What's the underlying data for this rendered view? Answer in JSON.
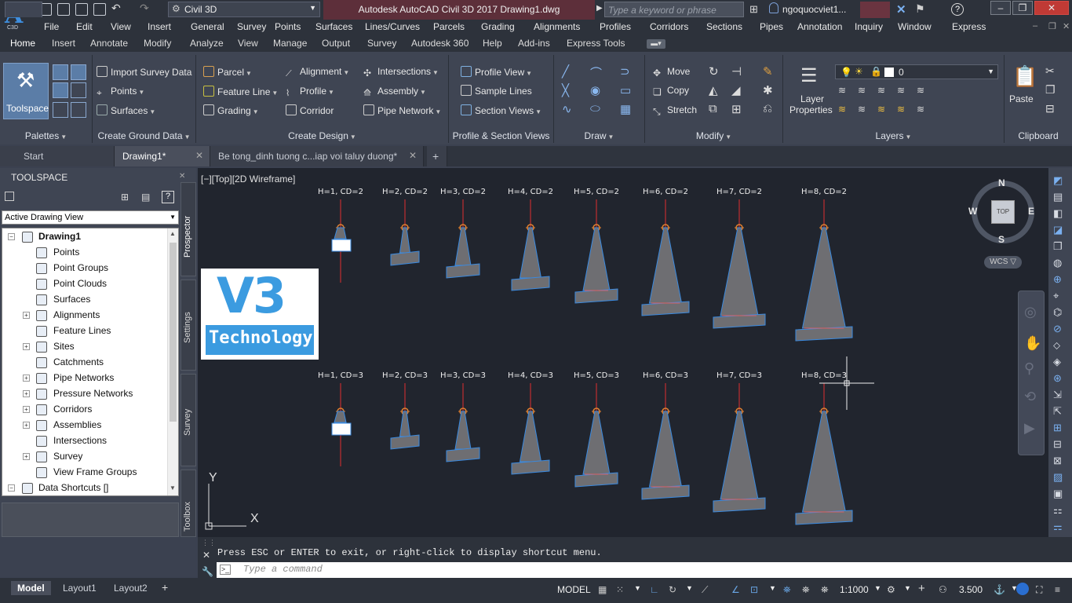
{
  "app": {
    "logo_letter": "A",
    "logo_sub": "C3D",
    "workspace": "Civil 3D",
    "title": "Autodesk AutoCAD Civil 3D 2017    Drawing1.dwg",
    "search_placeholder": "Type a keyword or phrase",
    "user": "ngoquocviet1...",
    "minimize": "–",
    "restore": "❐",
    "close": "✕"
  },
  "menu": [
    "File",
    "Edit",
    "View",
    "Insert",
    "General",
    "Survey",
    "Points",
    "Surfaces",
    "Lines/Curves",
    "Parcels",
    "Grading",
    "Alignments",
    "Profiles",
    "Corridors",
    "Sections",
    "Pipes",
    "Annotation",
    "Inquiry",
    "Window",
    "Express"
  ],
  "ribbon_tabs": [
    "Home",
    "Insert",
    "Annotate",
    "Modify",
    "Analyze",
    "View",
    "Manage",
    "Output",
    "Survey",
    "Autodesk 360",
    "Help",
    "Add-ins",
    "Express Tools"
  ],
  "ribbon": {
    "toolspace": "Toolspace",
    "palettes_title": "Palettes",
    "import_survey": "Import Survey Data",
    "points": "Points",
    "surfaces": "Surfaces",
    "ground_title": "Create Ground Data",
    "parcel": "Parcel",
    "feature_line": "Feature Line",
    "grading": "Grading",
    "alignment": "Alignment",
    "profile": "Profile",
    "corridor": "Corridor",
    "intersections": "Intersections",
    "assembly": "Assembly",
    "pipe_network": "Pipe Network",
    "design_title": "Create Design",
    "profile_view": "Profile View",
    "sample_lines": "Sample Lines",
    "section_views": "Section Views",
    "views_title": "Profile & Section Views",
    "draw_title": "Draw",
    "move": "Move",
    "copy": "Copy",
    "stretch": "Stretch",
    "modify_title": "Modify",
    "layer_props_1": "Layer",
    "layer_props_2": "Properties",
    "layer_value": "0",
    "layers_title": "Layers",
    "paste": "Paste",
    "clipboard_title": "Clipboard"
  },
  "doc_tabs": [
    "Start",
    "Drawing1*",
    "Be tong_dinh tuong c...iap voi taluy duong*"
  ],
  "toolspace": {
    "title": "TOOLSPACE",
    "view": "Active Drawing View",
    "tree": [
      "Drawing1",
      "Points",
      "Point Groups",
      "Point Clouds",
      "Surfaces",
      "Alignments",
      "Feature Lines",
      "Sites",
      "Catchments",
      "Pipe Networks",
      "Pressure Networks",
      "Corridors",
      "Assemblies",
      "Intersections",
      "Survey",
      "View Frame Groups",
      "Data Shortcuts []"
    ],
    "vtabs": [
      "Prospector",
      "Settings",
      "Survey",
      "Toolbox"
    ]
  },
  "viewport": {
    "label": "[−][Top][2D Wireframe]",
    "logo_v3": "V3",
    "logo_tech": "Technology",
    "viewcube": {
      "N": "N",
      "S": "S",
      "E": "E",
      "W": "W",
      "top": "TOP",
      "wcs": "WCS ▽"
    },
    "ucs_x": "X",
    "ucs_y": "Y",
    "row1_labels": [
      "H=1, CD=2",
      "H=2, CD=2",
      "H=3, CD=2",
      "H=4, CD=2",
      "H=5, CD=2",
      "H=6, CD=2",
      "H=7, CD=2",
      "H=8, CD=2"
    ],
    "row2_labels": [
      "H=1, CD=3",
      "H=2, CD=3",
      "H=3, CD=3",
      "H=4, CD=3",
      "H=5, CD=3",
      "H=6, CD=3",
      "H=7, CD=3",
      "H=8, CD=3"
    ]
  },
  "command": {
    "message": "Press ESC or ENTER to exit, or right-click to display shortcut menu.",
    "placeholder": "Type a command"
  },
  "status": {
    "layouts": [
      "Model",
      "Layout1",
      "Layout2"
    ],
    "plus": "+",
    "model": "MODEL",
    "scale": "1:1000",
    "value": "3.500"
  }
}
